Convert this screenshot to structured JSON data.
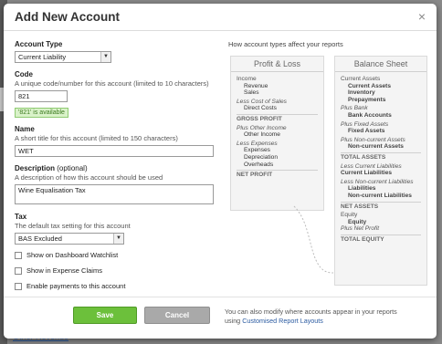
{
  "background": {
    "link": "Other Revenue"
  },
  "dialog": {
    "title": "Add New Account",
    "close_symbol": "×"
  },
  "form": {
    "account_type": {
      "label": "Account Type",
      "value": "Current Liability"
    },
    "code": {
      "label": "Code",
      "hint": "A unique code/number for this account (limited to 10 characters)",
      "value": "821",
      "status": "'821' is available"
    },
    "name": {
      "label": "Name",
      "hint": "A short title for this account (limited to 150 characters)",
      "value": "WET"
    },
    "description": {
      "label": "Description",
      "label_optional": "(optional)",
      "hint": "A description of how this account should be used",
      "value": "Wine Equalisation Tax"
    },
    "tax": {
      "label": "Tax",
      "hint": "The default tax setting for this account",
      "value": "BAS Excluded"
    },
    "checkboxes": [
      {
        "label": "Show on Dashboard Watchlist"
      },
      {
        "label": "Show in Expense Claims"
      },
      {
        "label": "Enable payments to this account"
      }
    ]
  },
  "diagram": {
    "title": "How account types affect your reports",
    "profit_loss": {
      "title": "Profit & Loss",
      "income": "Income",
      "revenue": "Revenue",
      "sales": "Sales",
      "less_cost": "Less Cost of Sales",
      "direct_costs": "Direct Costs",
      "gross_profit": "GROSS PROFIT",
      "plus_other_income": "Plus Other Income",
      "other_income": "Other Income",
      "less_expenses": "Less Expenses",
      "expenses": "Expenses",
      "depreciation": "Depreciation",
      "overheads": "Overheads",
      "net_profit": "NET PROFIT"
    },
    "balance_sheet": {
      "title": "Balance Sheet",
      "current_assets": "Current Assets",
      "current_assets_item": "Current Assets",
      "inventory": "Inventory",
      "prepayments": "Prepayments",
      "plus_bank": "Plus Bank",
      "bank_accounts": "Bank Accounts",
      "plus_fixed_assets": "Plus Fixed Assets",
      "fixed_assets": "Fixed Assets",
      "plus_noncurrent_assets": "Plus Non-current Assets",
      "noncurrent_assets": "Non-current Assets",
      "total_assets": "TOTAL ASSETS",
      "less_current_liabilities": "Less Current Liabilities",
      "current_liabilities": "Current Liabilities",
      "less_noncurrent_liabilities": "Less Non-current Liabilities",
      "liabilities": "Liabilities",
      "noncurrent_liabilities": "Non-current Liabilities",
      "net_assets": "NET ASSETS",
      "equity": "Equity",
      "equity_item": "Equity",
      "plus_net_profit": "Plus Net Profit",
      "total_equity": "TOTAL EQUITY"
    }
  },
  "footer": {
    "save": "Save",
    "cancel": "Cancel",
    "note_line1": "You can also modify where accounts appear in your reports",
    "note_line2_prefix": "using",
    "note_link": "Customised Report Layouts"
  },
  "colors": {
    "save": "#6cc03b",
    "cancel": "#a9a9a9",
    "available": "#d9f2c9",
    "link": "#2a5aa0"
  }
}
